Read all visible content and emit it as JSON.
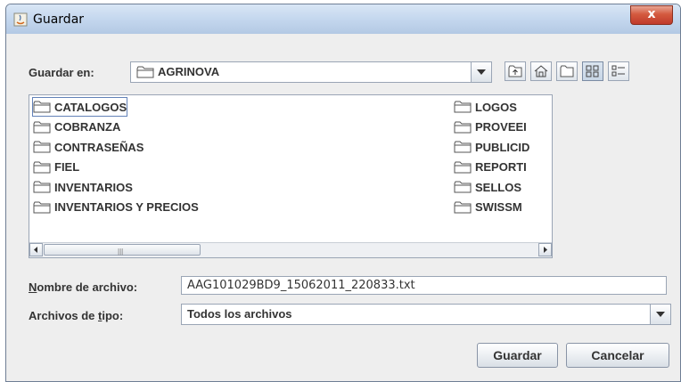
{
  "window": {
    "title": "Guardar",
    "close_symbol": "x"
  },
  "look_in": {
    "label": "Guardar en:",
    "folder": "AGRINOVA"
  },
  "toolbar": {
    "buttons": [
      {
        "icon": "up-one-level-icon"
      },
      {
        "icon": "home-icon"
      },
      {
        "icon": "new-folder-icon"
      },
      {
        "icon": "list-view-icon"
      },
      {
        "icon": "details-view-icon"
      }
    ]
  },
  "file_list": {
    "column1": [
      "CATALOGOS",
      "COBRANZA",
      "CONTRASEÑAS",
      "FIEL",
      "INVENTARIOS",
      "INVENTARIOS Y PRECIOS"
    ],
    "column2": [
      "LOGOS",
      "PROVEEI",
      "PUBLICID",
      "REPORTI",
      "SELLOS",
      "SWISSM"
    ],
    "selected": "CATALOGOS"
  },
  "filename": {
    "label_prefix": "N",
    "label_rest": "ombre de archivo:",
    "value": "AAG101029BD9_15062011_220833.txt"
  },
  "filetype": {
    "label_prefix": "Archivos de ",
    "label_u": "t",
    "label_rest": "ipo:",
    "value": "Todos los archivos"
  },
  "buttons": {
    "save": "Guardar",
    "cancel": "Cancelar"
  }
}
